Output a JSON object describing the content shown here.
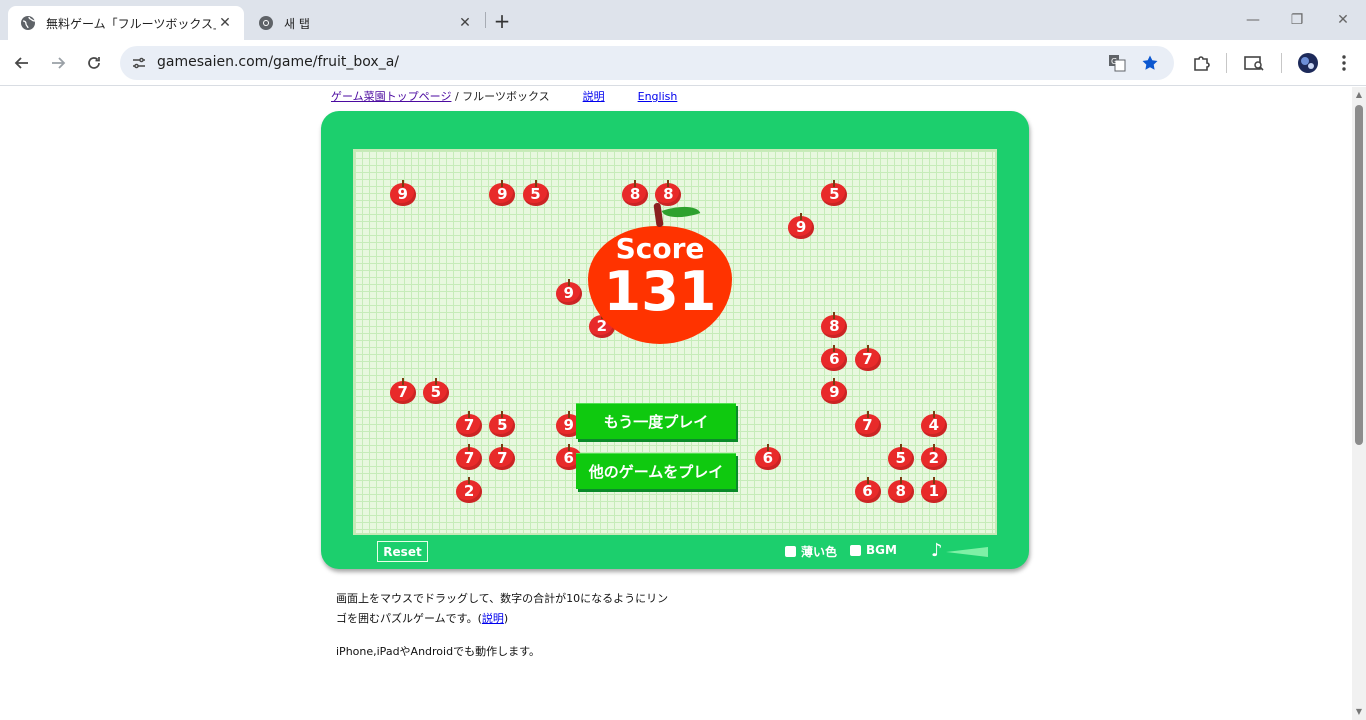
{
  "browser": {
    "tabs": [
      {
        "title": "無料ゲーム「フルーツボックス」",
        "active": true
      },
      {
        "title": "새 탭",
        "active": false
      }
    ],
    "url": "gamesaien.com/game/fruit_box_a/"
  },
  "breadcrumb": {
    "home_link": "ゲーム菜園トップページ",
    "separator": "/",
    "current": "フルーツボックス",
    "help_link": "説明",
    "english_link": "English"
  },
  "game": {
    "score_label": "Score",
    "score_value": "131",
    "replay_button": "もう一度プレイ",
    "other_games_button": "他のゲームをプレイ",
    "reset_button": "Reset",
    "pale_color_option": "薄い色",
    "bgm_option": "BGM",
    "volume_icon": "music-note-icon",
    "colors": {
      "frame": "#1ccf6d",
      "board": "#e8f8df",
      "apple": "#e82a2a",
      "score_apple": "#ff3300",
      "button": "#0fc90f"
    },
    "apples": [
      {
        "n": "9",
        "col": 1,
        "row": 1
      },
      {
        "n": "9",
        "col": 4,
        "row": 1
      },
      {
        "n": "5",
        "col": 5,
        "row": 1
      },
      {
        "n": "8",
        "col": 8,
        "row": 1
      },
      {
        "n": "8",
        "col": 9,
        "row": 1
      },
      {
        "n": "5",
        "col": 14,
        "row": 1
      },
      {
        "n": "9",
        "col": 13,
        "row": 2
      },
      {
        "n": "9",
        "col": 6,
        "row": 4
      },
      {
        "n": "2",
        "col": 7,
        "row": 5
      },
      {
        "n": "8",
        "col": 14,
        "row": 5
      },
      {
        "n": "6",
        "col": 14,
        "row": 6
      },
      {
        "n": "7",
        "col": 15,
        "row": 6
      },
      {
        "n": "7",
        "col": 1,
        "row": 7
      },
      {
        "n": "5",
        "col": 2,
        "row": 7
      },
      {
        "n": "9",
        "col": 14,
        "row": 7
      },
      {
        "n": "7",
        "col": 3,
        "row": 8
      },
      {
        "n": "5",
        "col": 4,
        "row": 8
      },
      {
        "n": "9",
        "col": 6,
        "row": 8
      },
      {
        "n": "7",
        "col": 15,
        "row": 8
      },
      {
        "n": "4",
        "col": 17,
        "row": 8
      },
      {
        "n": "7",
        "col": 3,
        "row": 9
      },
      {
        "n": "7",
        "col": 4,
        "row": 9
      },
      {
        "n": "6",
        "col": 6,
        "row": 9
      },
      {
        "n": "6",
        "col": 12,
        "row": 9
      },
      {
        "n": "5",
        "col": 16,
        "row": 9
      },
      {
        "n": "2",
        "col": 17,
        "row": 9
      },
      {
        "n": "2",
        "col": 3,
        "row": 10
      },
      {
        "n": "6",
        "col": 15,
        "row": 10
      },
      {
        "n": "8",
        "col": 16,
        "row": 10
      },
      {
        "n": "1",
        "col": 17,
        "row": 10
      }
    ]
  },
  "description": {
    "line1": "画面上をマウスでドラッグして、数字の合計が10になるようにリン",
    "line2_pre": "ゴを囲むパズルゲームです。(",
    "line2_link": "説明",
    "line2_post": ")",
    "line3": "iPhone,iPadやAndroidでも動作します。"
  }
}
